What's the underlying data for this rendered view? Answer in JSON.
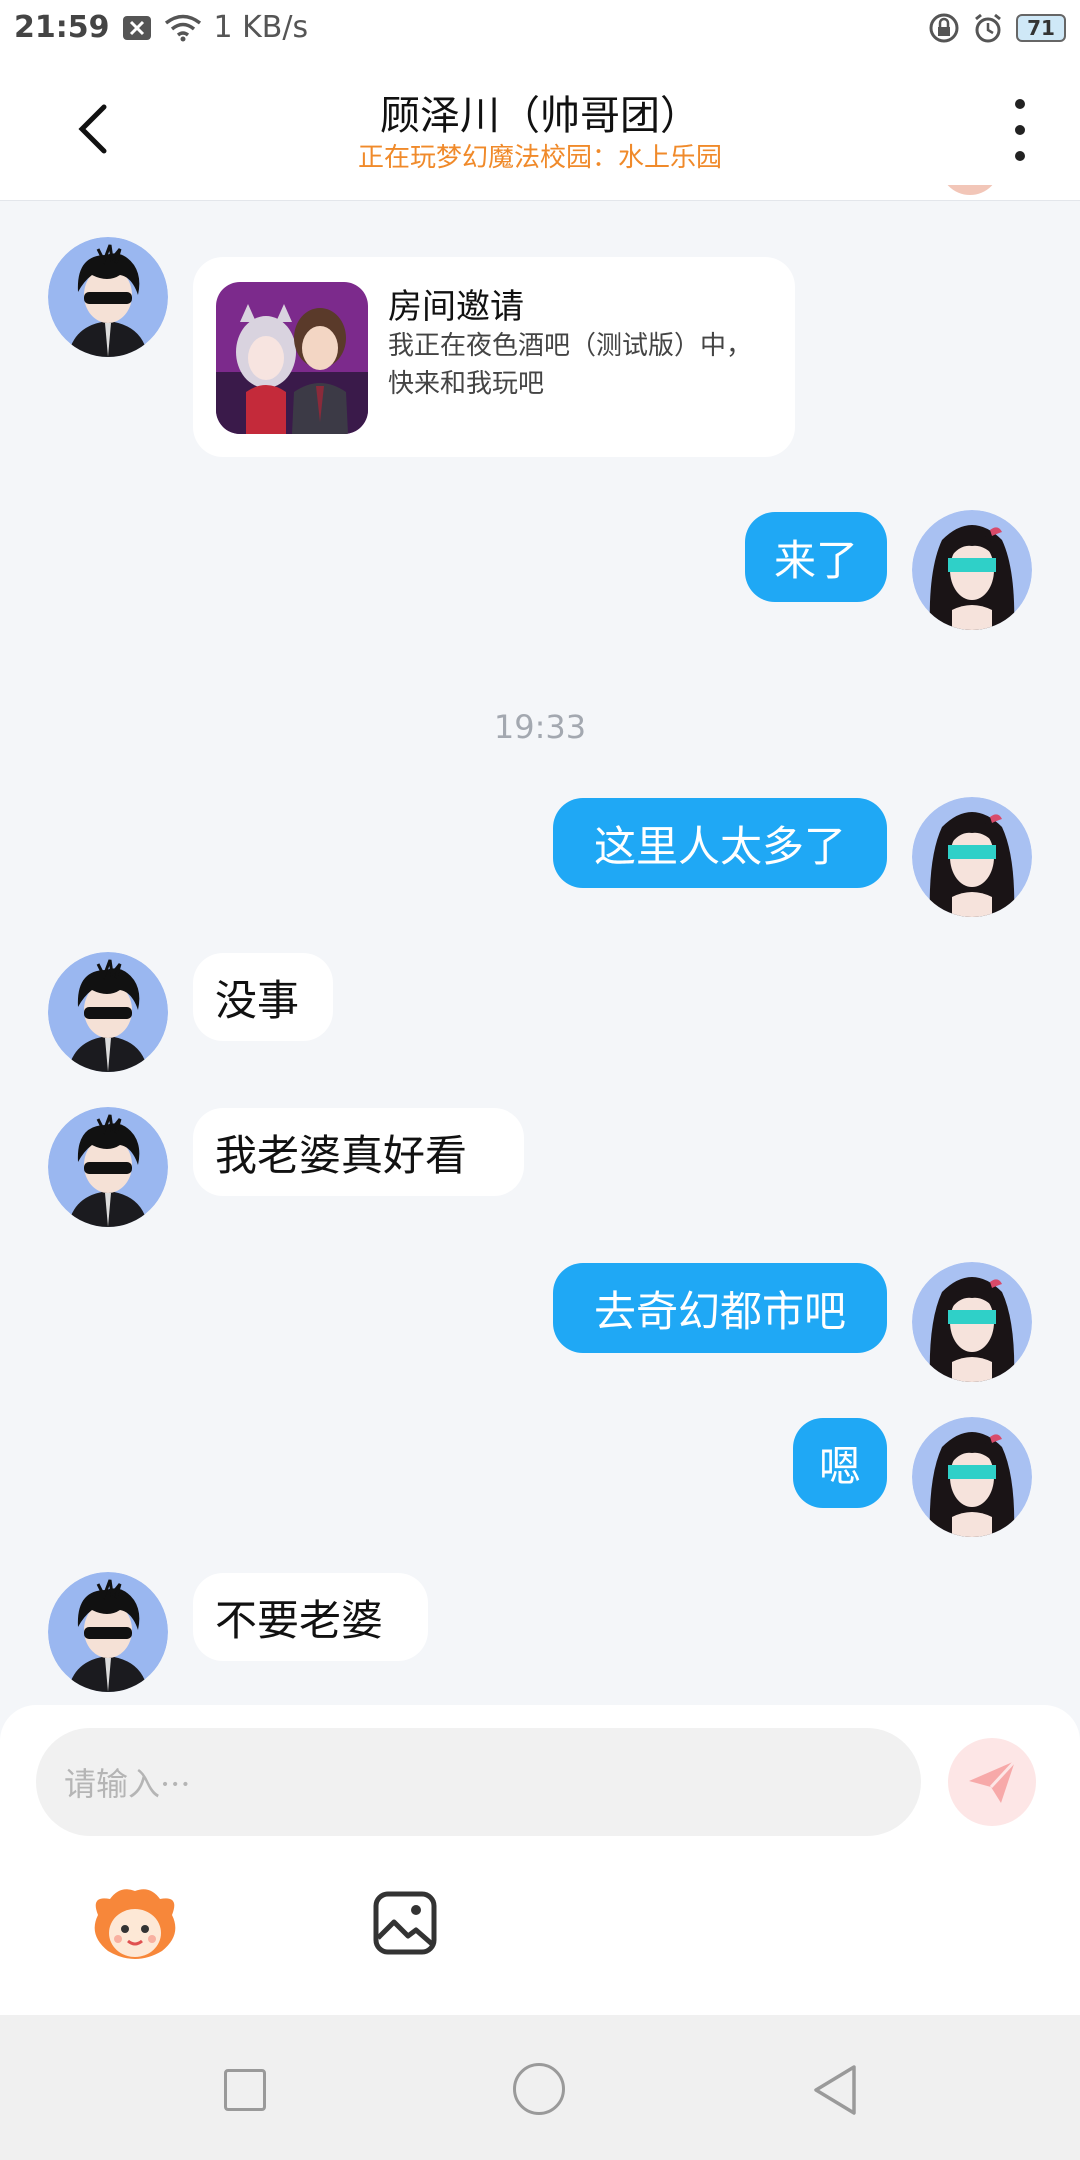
{
  "status_bar": {
    "time": "21:59",
    "net_speed": "1 KB/s",
    "battery": "71",
    "icons": [
      "notification-off-icon",
      "wifi-icon",
      "lock-rotation-icon",
      "alarm-icon",
      "battery-icon"
    ]
  },
  "header": {
    "title": "顾泽川（帅哥团）",
    "subtitle": "正在玩梦幻魔法校园：水上乐园"
  },
  "chat": {
    "invite_card": {
      "title": "房间邀请",
      "desc": "我正在夜色酒吧（测试版）中，快来和我玩吧"
    },
    "msg_1": "来了",
    "timestamp": "19:33",
    "msg_2": "这里人太多了",
    "msg_3": "没事",
    "msg_4": "我老婆真好看",
    "msg_5": "去奇幻都市吧",
    "msg_6": "嗯",
    "msg_7": "不要老婆"
  },
  "composer": {
    "placeholder": "请输入···"
  },
  "colors": {
    "outgoing_bubble": "#1fa8f5",
    "incoming_bubble": "#ffffff",
    "subtitle": "#f08a2a",
    "send_button": "#fde6e6"
  }
}
